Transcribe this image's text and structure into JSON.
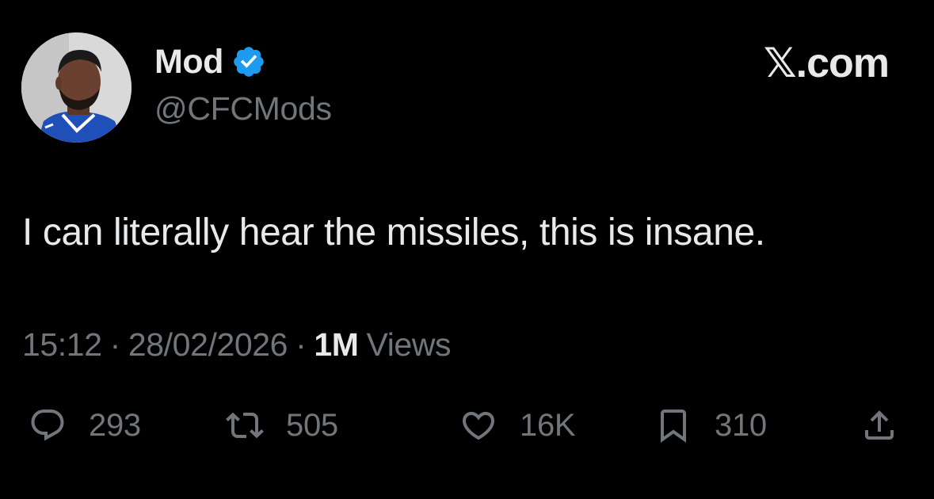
{
  "author": {
    "display_name": "Mod",
    "handle": "@CFCMods",
    "verified": true
  },
  "site_mark": "𝕏.com",
  "tweet": {
    "text": "I can literally hear the missiles, this is insane."
  },
  "meta": {
    "time": "15:12",
    "separator": "·",
    "date": "28/02/2026",
    "views_count": "1M",
    "views_label": "Views"
  },
  "actions": {
    "reply": {
      "icon": "reply-icon",
      "count": "293"
    },
    "repost": {
      "icon": "repost-icon",
      "count": "505"
    },
    "like": {
      "icon": "heart-icon",
      "count": "16K"
    },
    "bookmark": {
      "icon": "bookmark-icon",
      "count": "310"
    },
    "share": {
      "icon": "share-icon"
    }
  },
  "colors": {
    "background": "#000000",
    "primary_text": "#e7e9ea",
    "secondary_text": "#71767b",
    "verified_blue": "#1d9bf0"
  }
}
